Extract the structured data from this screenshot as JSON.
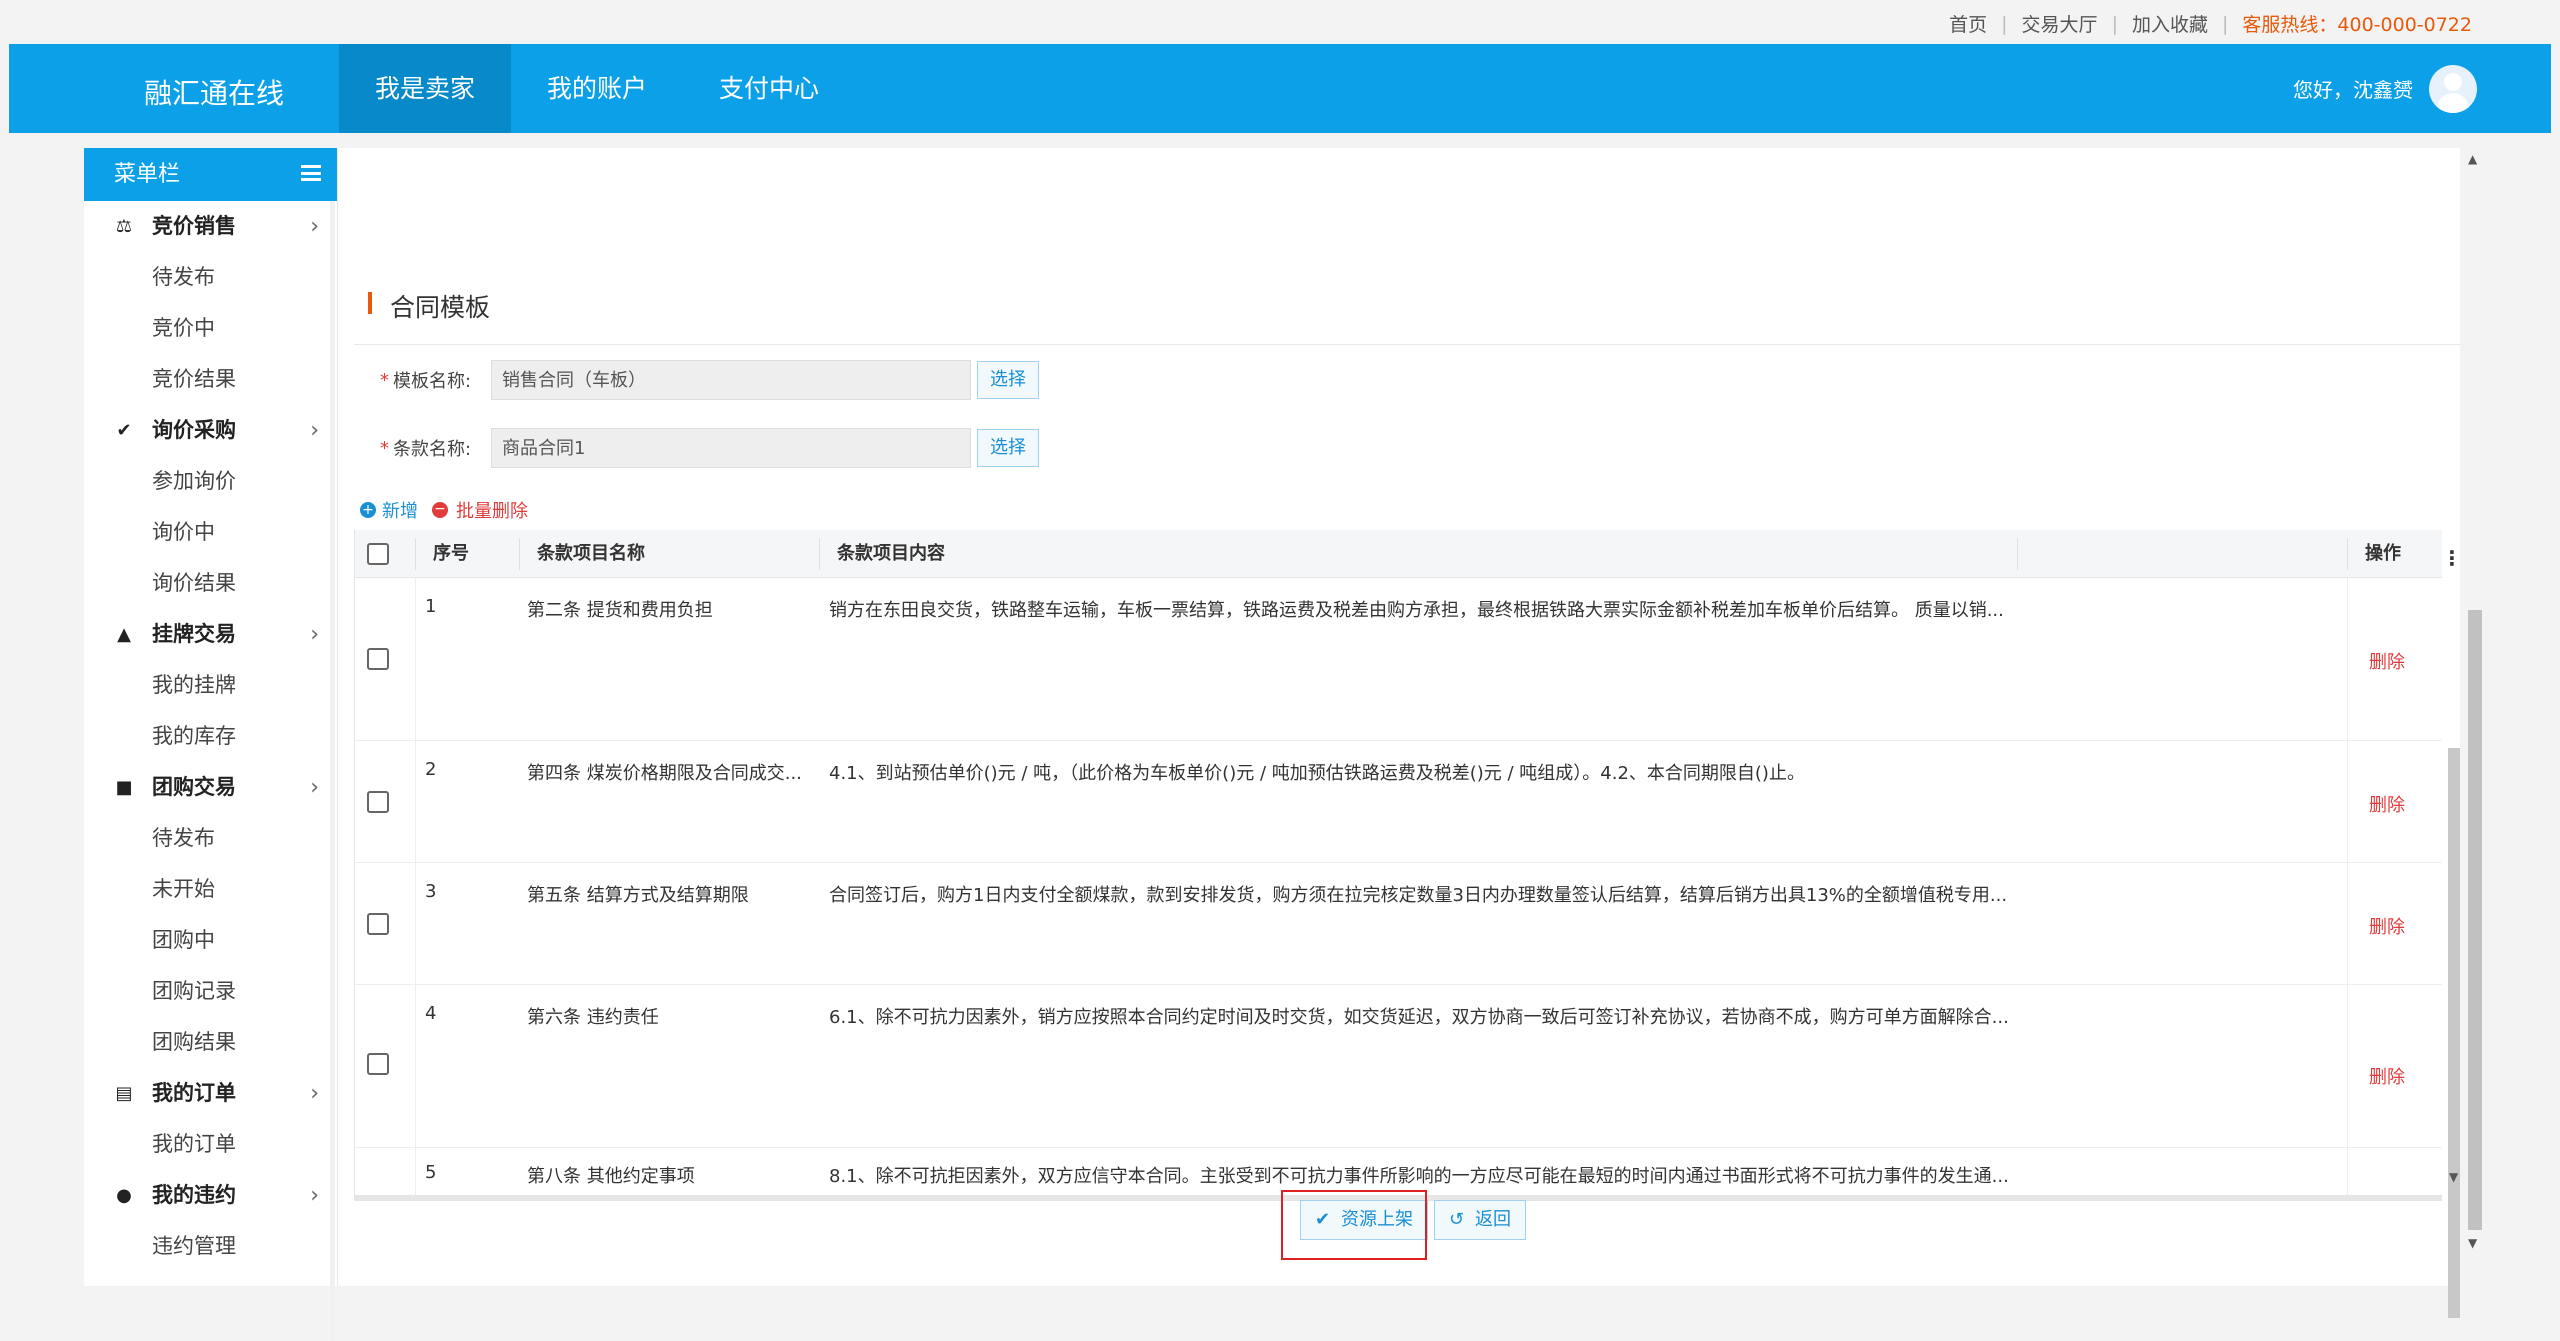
{
  "topbar": {
    "links": [
      "首页",
      "交易大厅",
      "加入收藏"
    ],
    "hotline": "客服热线：400-000-0722"
  },
  "header": {
    "logo": "融汇通在线",
    "nav": [
      "我是卖家",
      "我的账户",
      "支付中心"
    ],
    "active_nav": "我是卖家",
    "greeting": "您好，沈鑫赟"
  },
  "sidebar": {
    "title": "菜单栏",
    "groups": [
      {
        "label": "竞价销售",
        "icon": "gavel-icon",
        "items": [
          "待发布",
          "竞价中",
          "竞价结果"
        ]
      },
      {
        "label": "询价采购",
        "icon": "check-circle-icon",
        "items": [
          "参加询价",
          "询价中",
          "询价结果"
        ]
      },
      {
        "label": "挂牌交易",
        "icon": "graduation-cap-icon",
        "items": [
          "我的挂牌",
          "我的库存"
        ]
      },
      {
        "label": "团购交易",
        "icon": "shop-icon",
        "items": [
          "待发布",
          "未开始",
          "团购中",
          "团购记录",
          "团购结果"
        ]
      },
      {
        "label": "我的订单",
        "icon": "document-icon",
        "items": [
          "我的订单"
        ]
      },
      {
        "label": "我的违约",
        "icon": "alert-circle-icon",
        "items": [
          "违约管理"
        ]
      }
    ]
  },
  "contract": {
    "section_title": "合同模板",
    "template_label": "模板名称:",
    "template_value": "销售合同（车板）",
    "clause_label": "条款名称:",
    "clause_value": "商品合同1",
    "select_label": "选择",
    "add_label": "新增",
    "batch_delete_label": "批量删除"
  },
  "table": {
    "headers": {
      "index": "序号",
      "name": "条款项目名称",
      "content": "条款项目内容",
      "action": "操作"
    },
    "delete_label": "删除",
    "rows": [
      {
        "index": "1",
        "name": "第二条 提货和费用负担",
        "content": "销方在东田良交货，铁路整车运输，车板一票结算，铁路运费及税差由购方承担，最终根据铁路大票实际金额补税差加车板单价后结算。 质量以销..."
      },
      {
        "index": "2",
        "name": "第四条 煤炭价格期限及合同成交...",
        "content": "4.1、到站预估单价()元 / 吨，（此价格为车板单价()元 / 吨加预估铁路运费及税差()元 / 吨组成）。4.2、本合同期限自()止。"
      },
      {
        "index": "3",
        "name": "第五条 结算方式及结算期限",
        "content": "合同签订后，购方1日内支付全额煤款，款到安排发货，购方须在拉完核定数量3日内办理数量签认后结算，结算后销方出具13%的全额增值税专用..."
      },
      {
        "index": "4",
        "name": "第六条 违约责任",
        "content": "6.1、除不可抗力因素外，销方应按照本合同约定时间及时交货，如交货延迟，双方协商一致后可签订补充协议，若协商不成，购方可单方面解除合..."
      },
      {
        "index": "5",
        "name": "第八条 其他约定事项",
        "content": "8.1、除不可抗拒因素外，双方应信守本合同。主张受到不可抗力事件所影响的一方应尽可能在最短的时间内通过书面形式将不可抗力事件的发生通..."
      }
    ]
  },
  "footer_buttons": {
    "publish": "资源上架",
    "back": "返回"
  }
}
